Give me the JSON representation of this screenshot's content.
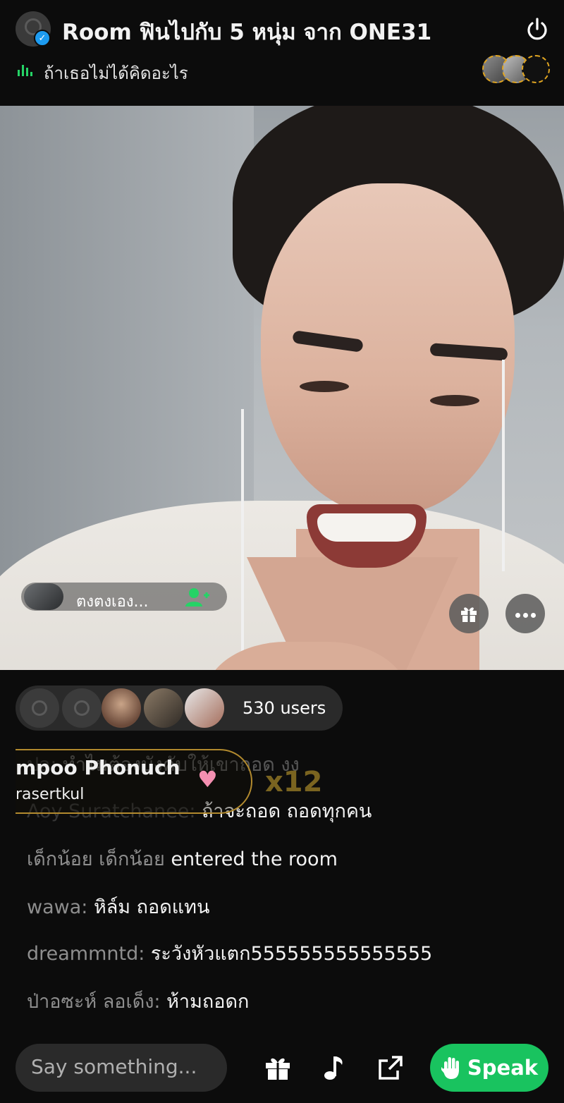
{
  "header": {
    "room_title": "Room ฟินไปกับ 5 หนุ่ม จาก ONE31",
    "now_playing": "ถ้าเธอไม่ได้คิดอะไร",
    "accent_color": "#25d366"
  },
  "video": {
    "speaker_name": "ตงตงเอง..."
  },
  "listeners": {
    "count_label": "530 users"
  },
  "gift": {
    "sender": "mpoo Phonuch",
    "sender_sub": "rasertkul",
    "count": "x12",
    "icon": "finger-heart-icon"
  },
  "chat": [
    {
      "name": "ปอ: ",
      "text": "ทำไมต้องบังคับให้เขาถอด งง",
      "faded": true
    },
    {
      "name": "Aoy Suratchanee: ",
      "text": "ถ้าจะถอด ถอดทุกคน",
      "faded": false
    },
    {
      "name": "เด็กน้อย เด็กน้อย ",
      "text": "entered the room",
      "faded": false
    },
    {
      "name": "wawa: ",
      "text": "หิล์ม ถอดแทน",
      "faded": false
    },
    {
      "name": "dreammntd: ",
      "text": "ระวังหัวแตก555555555555555",
      "faded": false
    },
    {
      "name": "ป่าอซะห์ ลอเด็ง: ",
      "text": "ห้ามถอดก",
      "faded": false
    }
  ],
  "bottom": {
    "input_placeholder": "Say something...",
    "speak_label": "Speak",
    "speak_color": "#19c35f"
  }
}
